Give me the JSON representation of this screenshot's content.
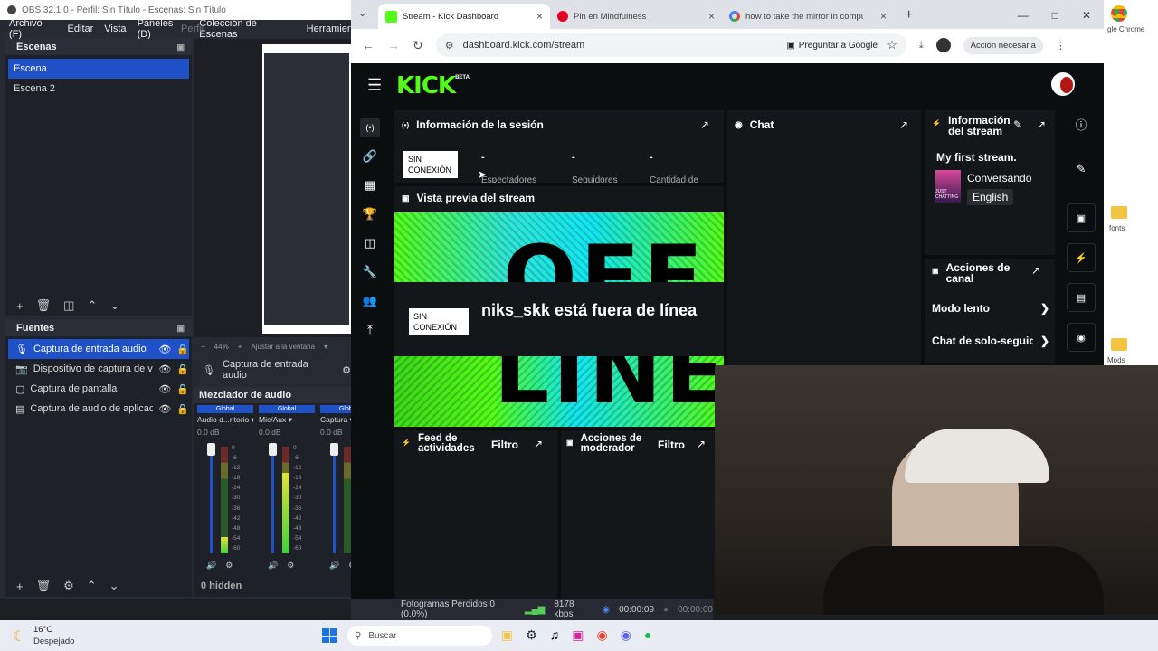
{
  "obs": {
    "title": "OBS 32.1.0 - Perfil: Sin Título - Escenas: Sin Título",
    "menu": [
      "Archivo (F)",
      "Editar",
      "Vista",
      "Paneles (D)",
      "Colección de Escenas",
      "Herramien"
    ],
    "menu_perfil": "Perfil",
    "scenes_title": "Escenas",
    "scenes": [
      "Escena",
      "Escena 2"
    ],
    "sources_title": "Fuentes",
    "sources": [
      "Captura de entrada audio",
      "Dispositivo de captura de video",
      "Captura de pantalla",
      "Captura de audio de aplicación"
    ],
    "preview_zoom": "44%",
    "preview_fit": "Ajustar a la ventana",
    "props_source": "Captura de entrada audio",
    "mixer_title": "Mezclador de audio",
    "mixer_channels": [
      {
        "tag": "Global",
        "name": "Audio d...ritorio",
        "db": "0.0 dB",
        "level": 0.15
      },
      {
        "tag": "Global",
        "name": "Mic/Aux",
        "db": "0.0 dB",
        "level": 0.75
      },
      {
        "tag": "Global",
        "name": "Captura",
        "db": "0.0 dB",
        "level": 0.0
      }
    ],
    "meter_ticks": [
      "0",
      "-6",
      "-12",
      "-18",
      "-24",
      "-30",
      "-36",
      "-42",
      "-48",
      "-54",
      "-60"
    ],
    "hidden_label": "0 hidden",
    "status": {
      "frames": "Fotogramas Perdidos 0 (0.0%)",
      "kbps": "8178 kbps",
      "time1": "00:00:09",
      "time2": "00:00:00"
    }
  },
  "browser": {
    "tabs": [
      {
        "title": "Stream - Kick Dashboard",
        "icon": "kick-icon",
        "active": true
      },
      {
        "title": "Pin en Mindfulness",
        "icon": "pinterest-icon",
        "active": false
      },
      {
        "title": "how to take the mirror in computer",
        "icon": "google-icon",
        "active": false
      }
    ],
    "url": "dashboard.kick.com/stream",
    "ask_google": "Preguntar a Google",
    "action_needed": "Acción necesaria"
  },
  "kick": {
    "logo": "KICK",
    "logo_beta": "BETA",
    "session_title": "Información de la sesión",
    "offline_badge": "SIN CONEXIÓN",
    "stats": [
      {
        "value": "-",
        "label": "Espectadores"
      },
      {
        "value": "-",
        "label": "Seguidores"
      },
      {
        "value": "-",
        "label": "Cantidad de"
      }
    ],
    "preview_title": "Vista previa del stream",
    "offline_message": "niks_skk está fuera de línea",
    "offline_banner_text": [
      "OFF",
      "LINE"
    ],
    "chat_title": "Chat",
    "stream_info_title": "Información del stream",
    "stream_title": "My first stream.",
    "category": "Conversando",
    "language": "English",
    "category_thumb_text": "JUST CHATTING",
    "channel_actions_title": "Acciones de canal",
    "channel_actions": [
      "Modo lento",
      "Chat de solo-seguid"
    ],
    "activity_title": "Feed de actividades",
    "filter_label": "Filtro",
    "mod_title": "Acciones de moderador"
  },
  "desktop": {
    "chrome_label": "gle Chrome",
    "folder1": "fonts",
    "folder2": "Mods"
  },
  "taskbar": {
    "temp": "16°C",
    "weather": "Despejado",
    "search": "Buscar"
  },
  "colors": {
    "kick_green": "#53fc18",
    "obs_blue": "#1f52c8",
    "kick_bg": "#0b0e0f"
  }
}
